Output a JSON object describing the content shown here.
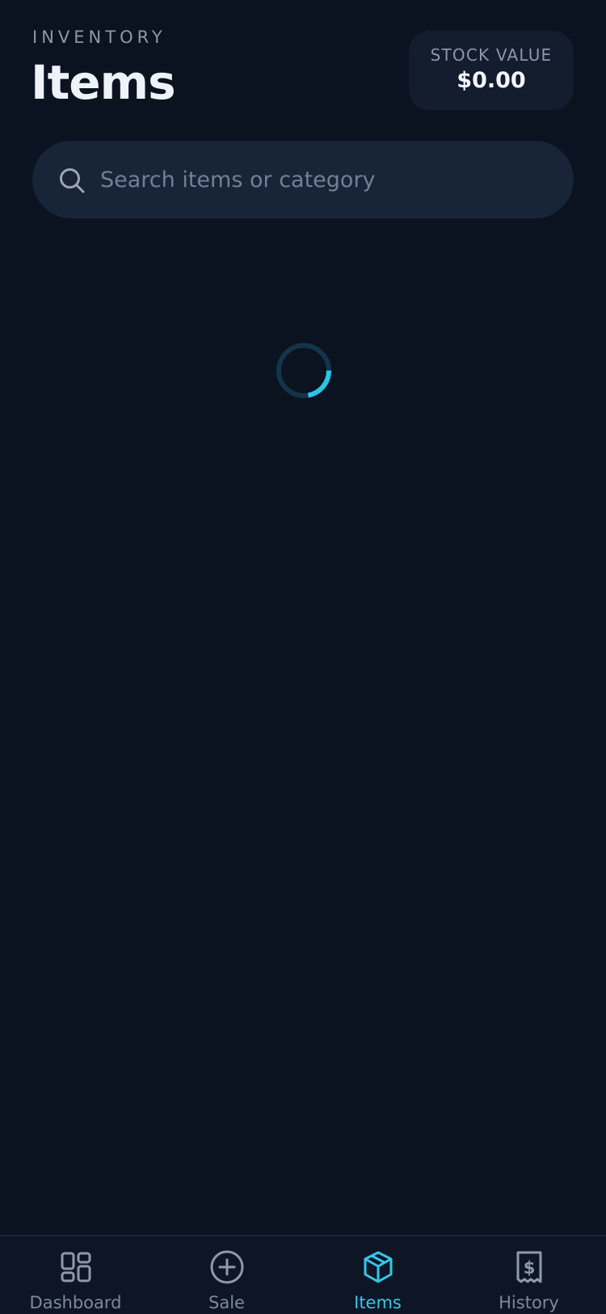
{
  "header": {
    "eyebrow": "INVENTORY",
    "title": "Items"
  },
  "stock": {
    "label": "STOCK VALUE",
    "value": "$0.00"
  },
  "search": {
    "placeholder": "Search items or category",
    "value": "",
    "icon": "search-icon"
  },
  "loading": {
    "icon": "loading-spinner-icon"
  },
  "nav": {
    "items": [
      {
        "label": "Dashboard",
        "icon": "dashboard-grid-icon",
        "active": false
      },
      {
        "label": "Sale",
        "icon": "plus-circle-icon",
        "active": false
      },
      {
        "label": "Items",
        "icon": "box-icon",
        "active": true
      },
      {
        "label": "History",
        "icon": "receipt-icon",
        "active": false
      }
    ]
  },
  "colors": {
    "background": "#0b1320",
    "surface": "#182438",
    "accent": "#35c6e8",
    "muted": "#7d889b",
    "text": "#eef3fa"
  }
}
